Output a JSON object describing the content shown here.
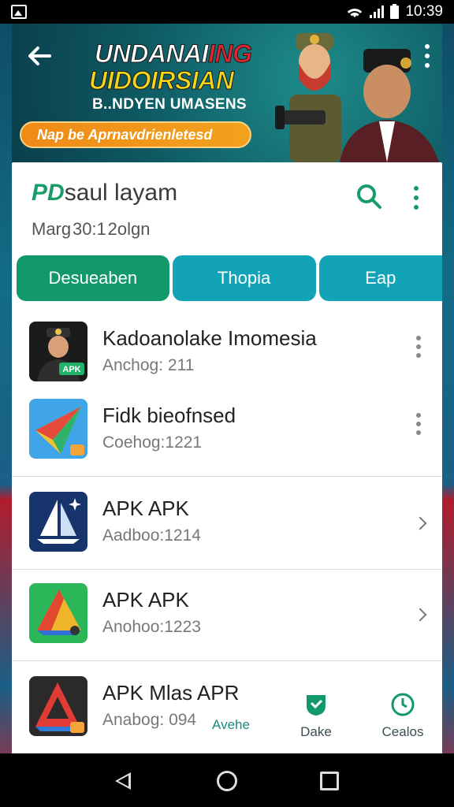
{
  "status_bar": {
    "time": "10:39"
  },
  "banner": {
    "title_line1_a": "UNDANAI",
    "title_line1_b": "ING",
    "title_line2": "UIDOIRSIAN",
    "subtitle": "B..NDYEN UMASENS",
    "pill_text": "Nap be Aprnavdrienletesd"
  },
  "header": {
    "title_brand": "PD",
    "title_rest": "saul layam",
    "subtitle": "Marg 30:1 2olgn"
  },
  "tabs": [
    {
      "label": "Desueaben"
    },
    {
      "label": "Thopia"
    },
    {
      "label": "Eap"
    }
  ],
  "apps": [
    {
      "title": "Kadoanolake Imomesia",
      "meta": "Anchog: 211",
      "icon": "soldier-apk-icon",
      "badge": "APK"
    },
    {
      "title": "Fidk bieofnsed",
      "meta": "Coehog:1221",
      "icon": "folded-ribbon-icon"
    },
    {
      "title": "APK APK",
      "meta": "Aadboo:1214",
      "icon": "sailboat-icon"
    },
    {
      "title": "APK APK",
      "meta": "Anohoo:1223",
      "icon": "triangle-logo-icon"
    },
    {
      "title": "APK Mlas APR",
      "meta": "Anabog: 094",
      "icon": "red-triangle-icon"
    }
  ],
  "bottom_tabs": [
    {
      "label": "Avehe",
      "icon": "none"
    },
    {
      "label": "Dake",
      "icon": "shield-check-icon"
    },
    {
      "label": "Cealos",
      "icon": "clock-icon"
    }
  ],
  "colors": {
    "primary": "#12996a",
    "secondary": "#13a3b6",
    "accent": "#f08a17"
  }
}
